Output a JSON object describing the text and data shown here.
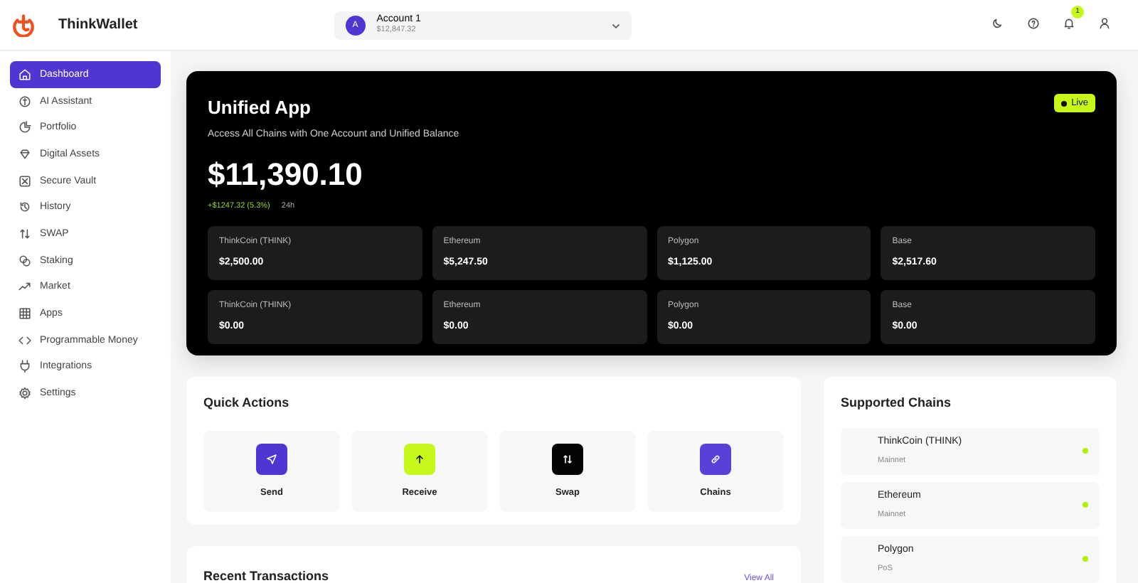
{
  "brand": {
    "name": "ThinkWallet"
  },
  "account": {
    "initial": "A",
    "name": "Account 1",
    "balance": "$12,847.32"
  },
  "notifications": {
    "badge": "1"
  },
  "sidebar": {
    "items": [
      {
        "label": "Dashboard",
        "selected": true
      },
      {
        "label": "AI Assistant",
        "selected": false
      },
      {
        "label": "Portfolio",
        "selected": false
      },
      {
        "label": "Digital Assets",
        "selected": false
      },
      {
        "label": "Secure Vault",
        "selected": false
      },
      {
        "label": "History",
        "selected": false
      },
      {
        "label": "SWAP",
        "selected": false
      },
      {
        "label": "Staking",
        "selected": false
      },
      {
        "label": "Market",
        "selected": false
      },
      {
        "label": "Apps",
        "selected": false
      },
      {
        "label": "Programmable Money",
        "selected": false
      },
      {
        "label": "Integrations",
        "selected": false
      },
      {
        "label": "Settings",
        "selected": false
      }
    ]
  },
  "hero": {
    "title": "Unified App",
    "subtitle": "Access All Chains with One Account and Unified Balance",
    "status": "Live",
    "live": true,
    "total": "$11,390.10",
    "change": "+$1247.32 (5.3%)",
    "period": "24h",
    "balances": [
      {
        "chain": "ThinkCoin (THINK)",
        "amount": "$2,500.00"
      },
      {
        "chain": "Ethereum",
        "amount": "$5,247.50"
      },
      {
        "chain": "Polygon",
        "amount": "$1,125.00"
      },
      {
        "chain": "Base",
        "amount": "$2,517.60"
      },
      {
        "chain": "ThinkCoin (THINK)",
        "amount": "$0.00"
      },
      {
        "chain": "Ethereum",
        "amount": "$0.00"
      },
      {
        "chain": "Polygon",
        "amount": "$0.00"
      },
      {
        "chain": "Base",
        "amount": "$0.00"
      }
    ]
  },
  "quick_actions": {
    "title": "Quick Actions",
    "actions": [
      {
        "label": "Send",
        "color": "#4f35d2"
      },
      {
        "label": "Receive",
        "color": "#c6f81c"
      },
      {
        "label": "Swap",
        "color": "#050505"
      },
      {
        "label": "Chains",
        "color": "#5a3fd8"
      }
    ]
  },
  "supported_chains": {
    "title": "Supported Chains",
    "chains": [
      {
        "name": "ThinkCoin (THINK)",
        "network": "Mainnet",
        "active": true
      },
      {
        "name": "Ethereum",
        "network": "Mainnet",
        "active": true
      },
      {
        "name": "Polygon",
        "network": "PoS",
        "active": true
      }
    ]
  },
  "recent_transactions": {
    "title": "Recent Transactions",
    "link": "View All"
  }
}
